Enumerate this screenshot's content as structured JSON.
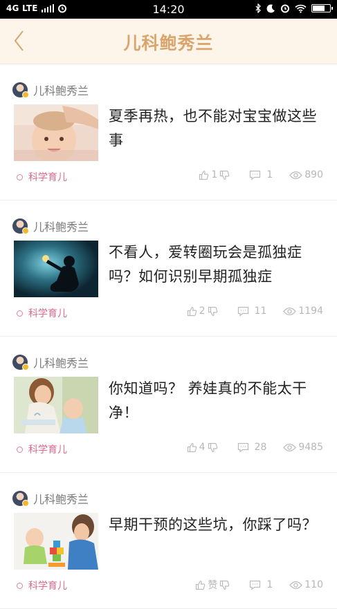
{
  "status_bar": {
    "network": "4G LTE",
    "time": "14:20",
    "battery_level": 0.75
  },
  "header": {
    "title": "儿科鲍秀兰"
  },
  "articles": [
    {
      "author": "儿科鲍秀兰",
      "title": "夏季再热，也不能对宝宝做这些事",
      "tag": "科学育儿",
      "likes": "1",
      "comments": "1",
      "views": "890",
      "thumbnail_icon": "baby-head-photo"
    },
    {
      "author": "儿科鲍秀兰",
      "title": "不看人，爱转圈玩会是孤独症吗？如何识别早期孤独症",
      "tag": "科学育儿",
      "likes": "2",
      "comments": "11",
      "views": "1194",
      "thumbnail_icon": "child-silhouette-photo"
    },
    {
      "author": "儿科鲍秀兰",
      "title": "你知道吗？ 养娃真的不能太干净！",
      "tag": "科学育儿",
      "likes": "4",
      "comments": "28",
      "views": "9485",
      "thumbnail_icon": "mother-baby-washing-photo"
    },
    {
      "author": "儿科鲍秀兰",
      "title": "早期干预的这些坑，你踩了吗？",
      "tag": "科学育儿",
      "likes": "赞",
      "comments": "1",
      "views": "110",
      "thumbnail_icon": "baby-blocks-photo"
    }
  ]
}
